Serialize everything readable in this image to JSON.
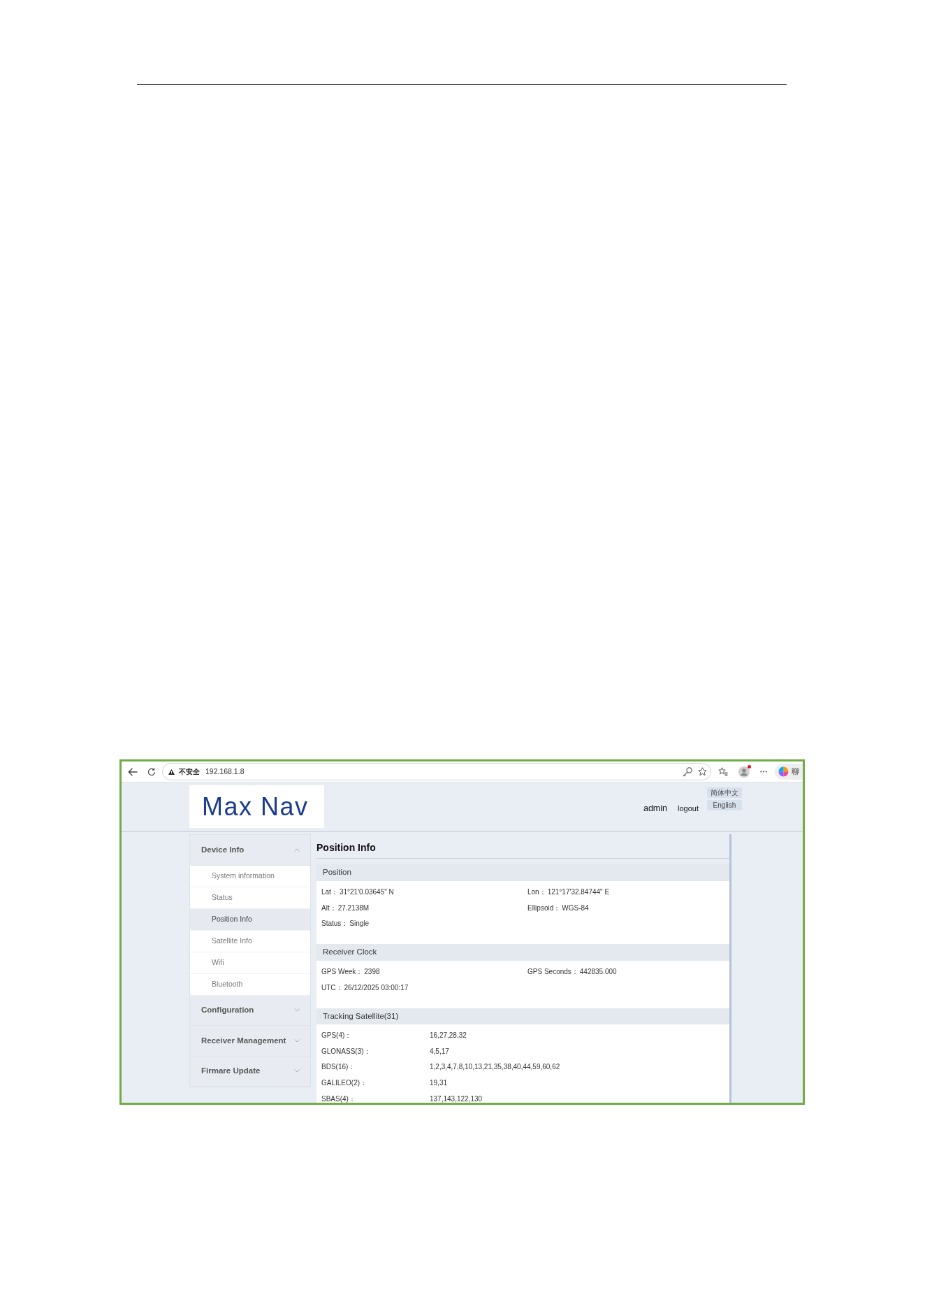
{
  "browser": {
    "security_label": "不安全",
    "url": "192.168.1.8",
    "chat_label": "聊"
  },
  "header": {
    "logo": "Max Nav",
    "user": "admin",
    "logout": "logout",
    "languages": [
      "简体中文",
      "English"
    ]
  },
  "sidebar": {
    "groups": [
      {
        "label": "Device Info",
        "expanded": true,
        "items": [
          {
            "label": "System information",
            "selected": false
          },
          {
            "label": "Status",
            "selected": false
          },
          {
            "label": "Position Info",
            "selected": true
          },
          {
            "label": "Satellite Info",
            "selected": false
          },
          {
            "label": "Wifi",
            "selected": false
          },
          {
            "label": "Bluetooth",
            "selected": false
          }
        ]
      },
      {
        "label": "Configuration",
        "expanded": false
      },
      {
        "label": "Receiver Management",
        "expanded": false
      },
      {
        "label": "Firmare Update",
        "expanded": false
      }
    ]
  },
  "main": {
    "title": "Position Info",
    "sections": [
      {
        "title": "Position",
        "kind": "grid",
        "fields": [
          {
            "label": "Lat：",
            "value": "31°21'0.03645\" N"
          },
          {
            "label": "Lon：",
            "value": "121°17'32.84744\" E"
          },
          {
            "label": "Alt：",
            "value": "27.2138M"
          },
          {
            "label": "Ellipsoid：",
            "value": "WGS-84"
          },
          {
            "label": "Status：",
            "value": "Single"
          }
        ]
      },
      {
        "title": "Receiver Clock",
        "kind": "grid",
        "fields": [
          {
            "label": "GPS Week：",
            "value": "2398"
          },
          {
            "label": "GPS Seconds：",
            "value": "442835.000"
          },
          {
            "label": "UTC：",
            "value": "26/12/2025 03:00:17"
          }
        ]
      },
      {
        "title": "Tracking Satellite(31)",
        "kind": "list",
        "fields": [
          {
            "label": "GPS(4)：",
            "value": "16,27,28,32"
          },
          {
            "label": "GLONASS(3)：",
            "value": "4,5,17"
          },
          {
            "label": "BDS(16)：",
            "value": "1,2,3,4,7,8,10,13,21,35,38,40,44,59,60,62"
          },
          {
            "label": "GALILEO(2)：",
            "value": "19,31"
          },
          {
            "label": "SBAS(4)：",
            "value": "137,143,122,130"
          }
        ]
      }
    ]
  }
}
